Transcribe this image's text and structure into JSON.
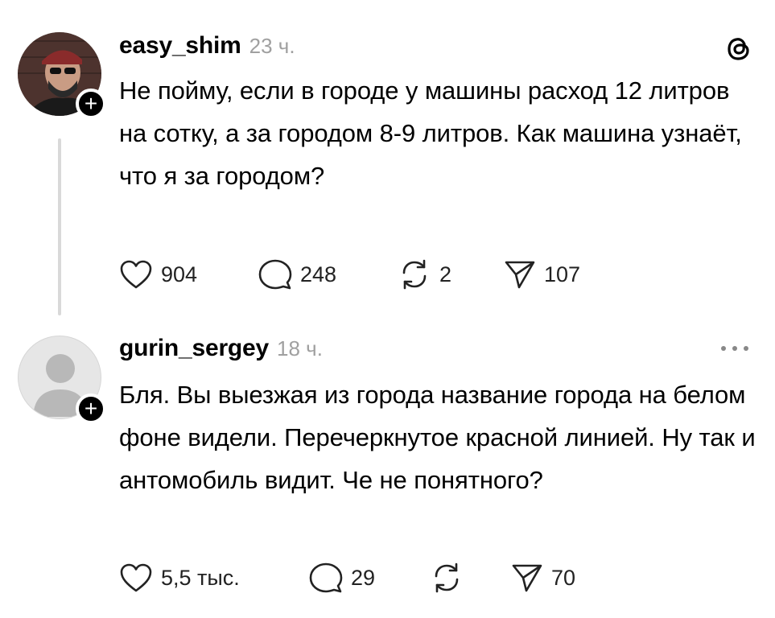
{
  "posts": [
    {
      "username": "easy_shim",
      "time": "23 ч.",
      "text": "Не пойму, если в городе у машины расход 12 литров на сотку, а за городом 8-9 литров. Как машина узнаёт, что я за городом?",
      "likes": "904",
      "replies": "248",
      "reposts": "2",
      "shares": "107",
      "avatar_icon": "user-photo-avatar",
      "corner_icon": "threads-logo-icon"
    },
    {
      "username": "gurin_sergey",
      "time": "18 ч.",
      "text": "Бля. Вы выезжая из города название города на белом фоне видели. Перечеркнутое красной линией. Ну так и антомобиль видит. Че не понятного?",
      "likes": "5,5 тыс.",
      "replies": "29",
      "reposts": "",
      "shares": "70",
      "avatar_icon": "default-user-avatar",
      "corner_icon": "more-options-icon"
    }
  ],
  "colors": {
    "text": "#000000",
    "muted": "#a0a0a0",
    "thread_line": "#d9d9d9",
    "default_avatar_bg": "#e6e6e6",
    "default_avatar_fg": "#b8b8b8"
  }
}
